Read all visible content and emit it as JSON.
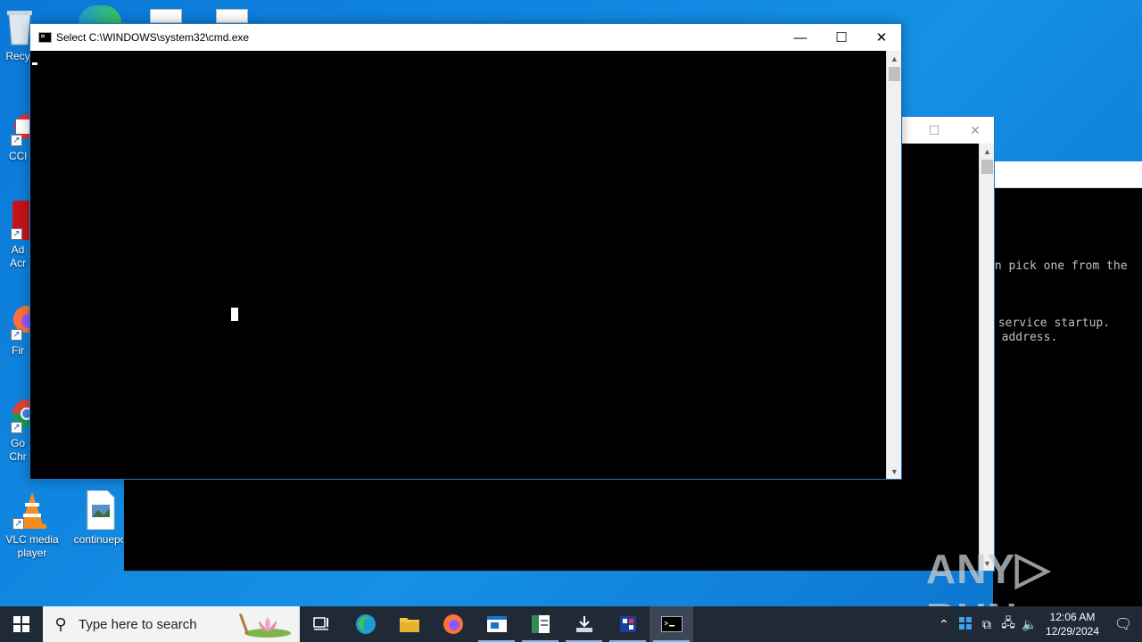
{
  "desktop": {
    "icons": [
      {
        "label": "Recy",
        "icon": "recycle-bin-icon"
      },
      {
        "label": "CCl",
        "icon": "ccleaner-icon"
      },
      {
        "label": "Ad\nAcr",
        "icon": "acrobat-icon"
      },
      {
        "label": "Fir",
        "icon": "firefox-icon"
      },
      {
        "label": "Go\nChr",
        "icon": "chrome-icon"
      },
      {
        "label": "VLC media player",
        "icon": "vlc-icon"
      },
      {
        "label": "continuepo",
        "icon": "image-file-icon"
      }
    ]
  },
  "main_window": {
    "title": "Select C:\\WINDOWS\\system32\\cmd.exe",
    "minimize": "—",
    "maximize": "☐",
    "close": "✕"
  },
  "back_window": {
    "maximize": "☐",
    "close": "✕"
  },
  "third_window": {
    "lines": [
      "an pick one from the",
      " service startup.",
      "t address."
    ]
  },
  "watermark": {
    "text_left": "ANY",
    "text_right": "RUN"
  },
  "taskbar": {
    "search_placeholder": "Type here to search",
    "clock_time": "12:06 AM",
    "clock_date": "12/29/2024"
  },
  "colors": {
    "accent": "#0a78d7",
    "taskbar": "#1f2a36"
  }
}
